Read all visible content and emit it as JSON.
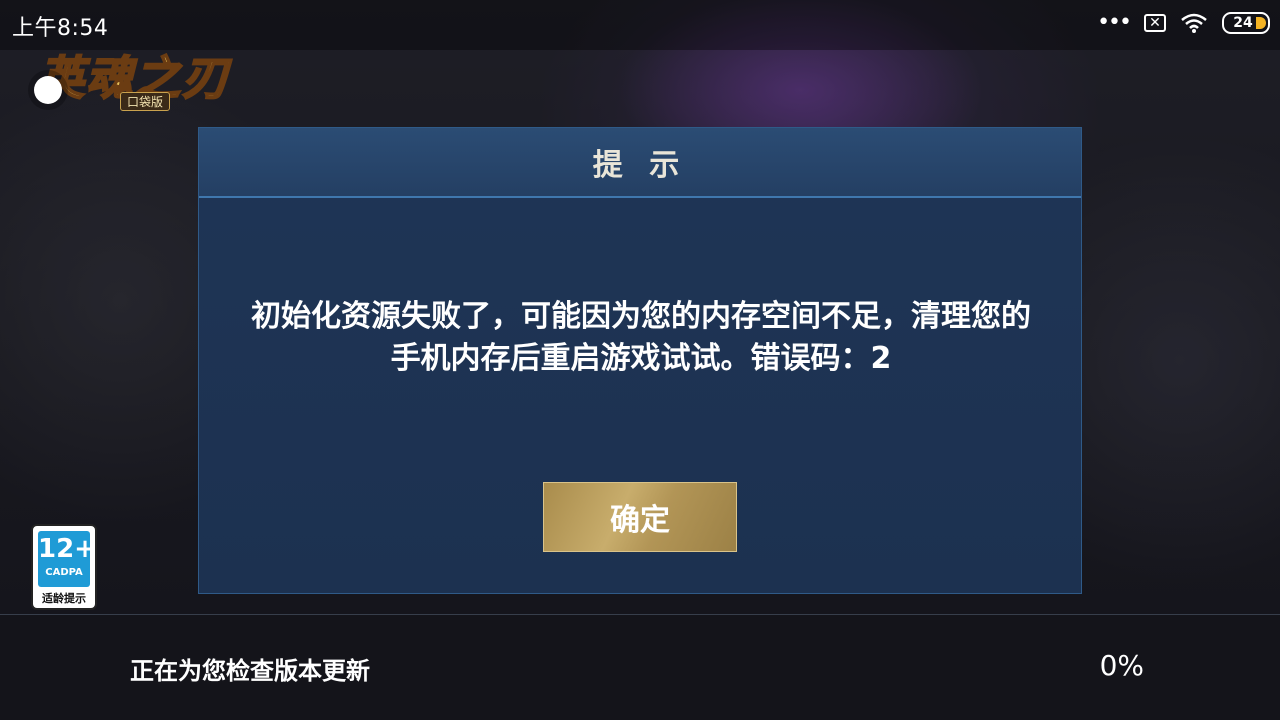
{
  "status_bar": {
    "time": "上午8:54",
    "more_icon": "more-dots-icon",
    "notification_icon": "close-box-icon",
    "wifi_icon": "wifi-icon",
    "battery_level": "24"
  },
  "logo": {
    "title": "英魂之刃",
    "subtitle": "口袋版"
  },
  "dialog": {
    "title": "提 示",
    "message": "初始化资源失败了，可能因为您的内存空间不足，清理您的手机内存后重启游戏试试。错误码：2",
    "confirm_label": "确定"
  },
  "age_rating": {
    "age": "12+",
    "org": "CADPA",
    "caption": "适龄提示"
  },
  "bottom": {
    "status": "正在为您检查版本更新",
    "progress": "0%"
  },
  "colors": {
    "dialog_bg": "#1f3556",
    "dialog_header": "#2b4c74",
    "button_gold": "#c8ad6c",
    "age_badge_blue": "#1f9bd6",
    "battery_fill": "#f4b323"
  }
}
